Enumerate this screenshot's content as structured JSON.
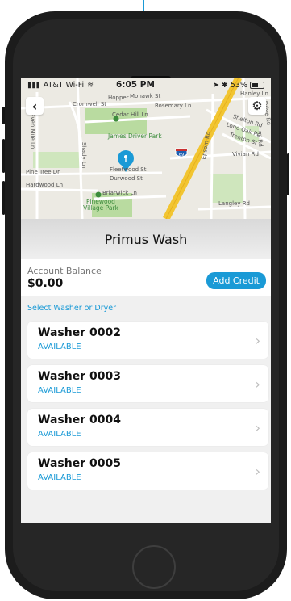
{
  "status_bar": {
    "carrier": "AT&T Wi-Fi",
    "time": "6:05 PM",
    "battery": "53%"
  },
  "map": {
    "labels": {
      "hopper": "Hopper",
      "mohawk": "Mohawk St",
      "cromwell": "Cromwell St",
      "rosemary": "Rosemary Ln",
      "cedar": "Cedar Hill Ln",
      "park": "James Driver Park",
      "shelton": "Shelton Rd",
      "lone_oak": "Lone Oak Rd",
      "trenton": "Trenton St",
      "vivian": "Vivian Rd",
      "pine_tree": "Pine Tree Dr",
      "fleetwood": "Fleetwood St",
      "durwood": "Durwood St",
      "hardwood": "Hardwood Ln",
      "briarwick": "Briarwick Ln",
      "pinewood": "Pinewood Village Park",
      "langley": "Langley Rd",
      "interstate": "69",
      "hanley": "Hanley Ln",
      "seven_mile": "Seven Mile Ln",
      "shady": "Shady Ln",
      "epsom": "Epsom Rd",
      "eli": "Eli Rd",
      "drive": "Drive Rd"
    },
    "colors": {
      "highway": "#f2c531",
      "park": "#b9dba0",
      "pin": "#1a9ad6"
    }
  },
  "title": "Primus Wash",
  "account": {
    "label": "Account Balance",
    "balance": "$0.00",
    "add_credit": "Add Credit"
  },
  "section_header": "Select Washer or Dryer",
  "machines": [
    {
      "name": "Washer 0002",
      "status": "AVAILABLE"
    },
    {
      "name": "Washer 0003",
      "status": "AVAILABLE"
    },
    {
      "name": "Washer 0004",
      "status": "AVAILABLE"
    },
    {
      "name": "Washer 0005",
      "status": "AVAILABLE"
    }
  ]
}
